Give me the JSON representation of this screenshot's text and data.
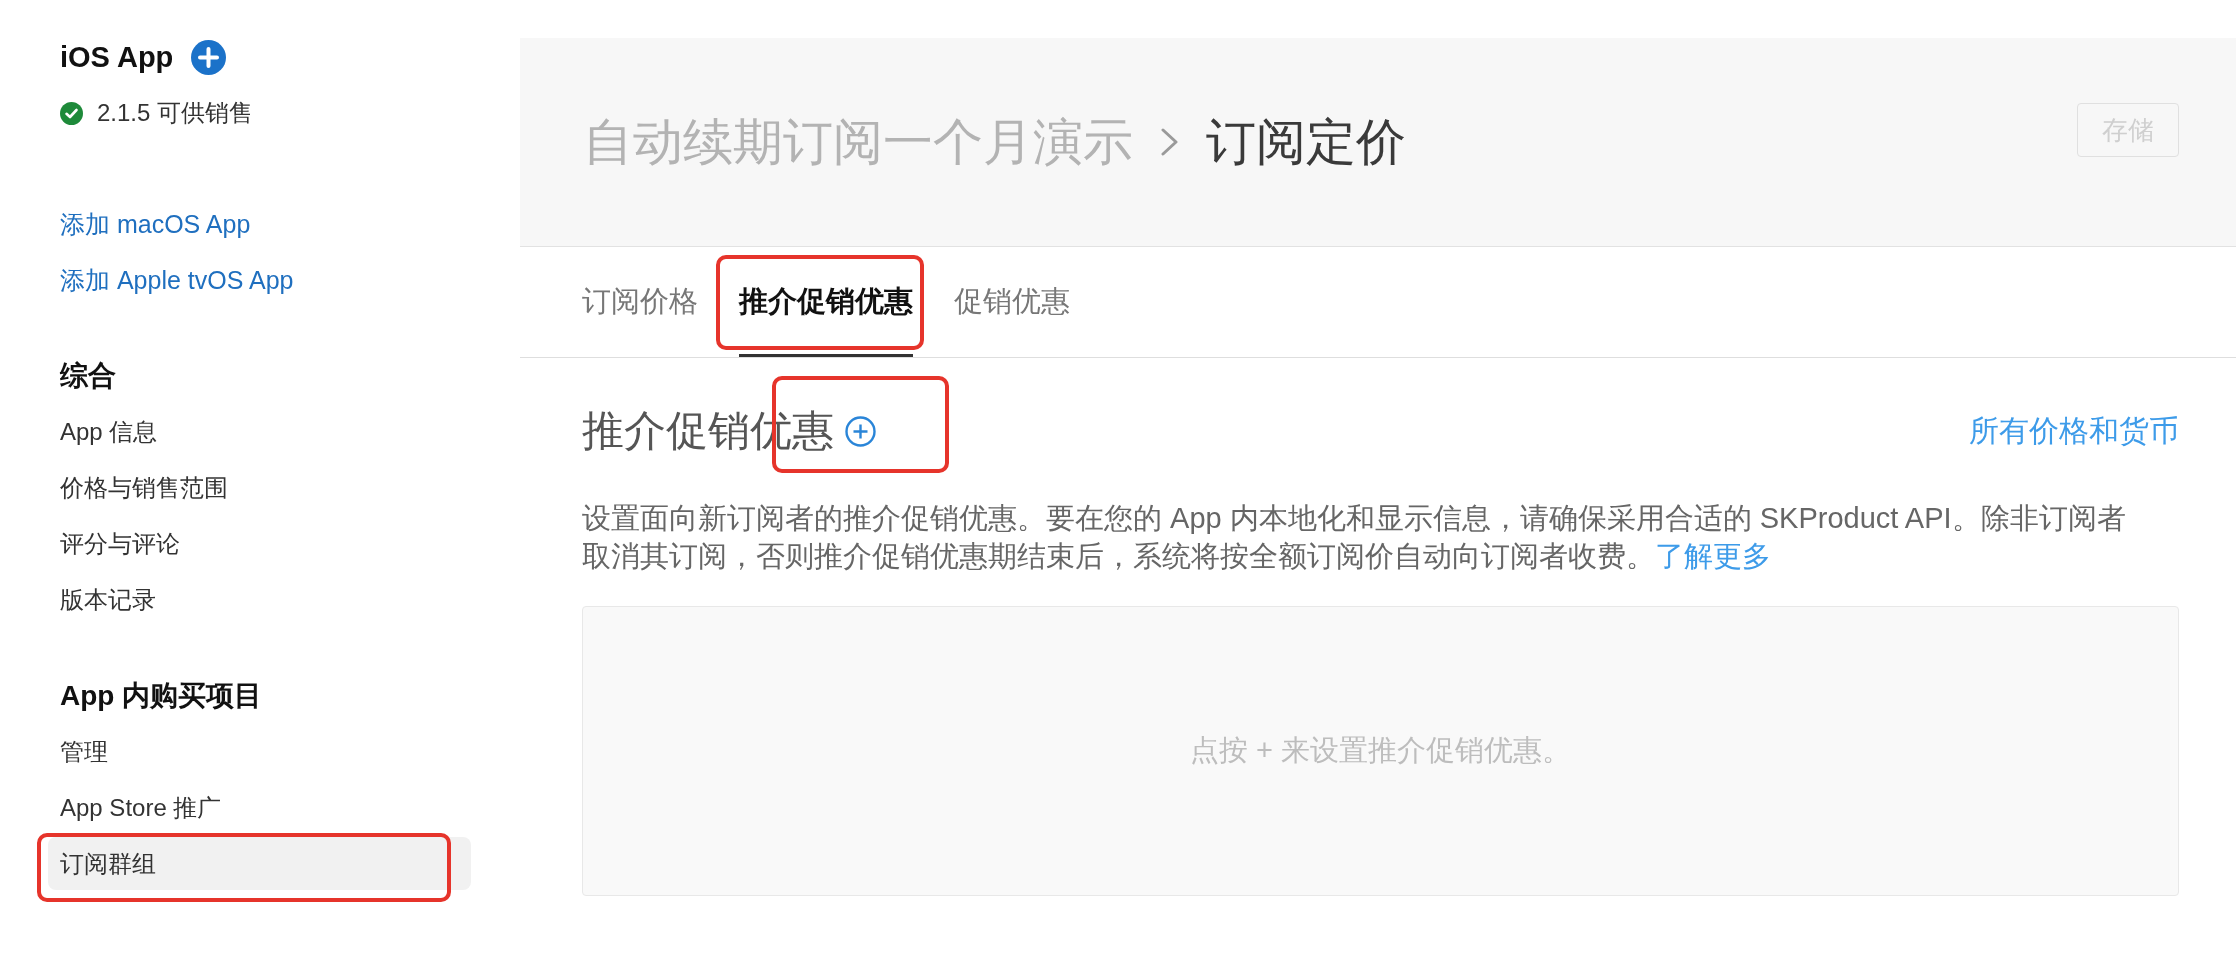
{
  "sidebar": {
    "app": {
      "title": "iOS App",
      "status": "2.1.5 可供销售"
    },
    "links": [
      "添加 macOS App",
      "添加 Apple tvOS App"
    ],
    "sections": [
      {
        "heading": "综合",
        "items": [
          {
            "label": "App 信息",
            "selected": false,
            "annotated": false
          },
          {
            "label": "价格与销售范围",
            "selected": false,
            "annotated": false
          },
          {
            "label": "评分与评论",
            "selected": false,
            "annotated": false
          },
          {
            "label": "版本记录",
            "selected": false,
            "annotated": false
          }
        ]
      },
      {
        "heading": "App 内购买项目",
        "items": [
          {
            "label": "管理",
            "selected": false,
            "annotated": false
          },
          {
            "label": "App Store 推广",
            "selected": false,
            "annotated": false
          },
          {
            "label": "订阅群组",
            "selected": true,
            "annotated": true
          }
        ]
      }
    ]
  },
  "header": {
    "breadcrumb": [
      {
        "label": "自动续期订阅一个月演示",
        "current": false
      },
      {
        "label": "订阅定价",
        "current": true
      }
    ],
    "save_button": {
      "label": "存储",
      "disabled": true
    }
  },
  "tabs": [
    {
      "label": "订阅价格",
      "selected": false,
      "annotated": false
    },
    {
      "label": "推介促销优惠",
      "selected": true,
      "annotated": true
    },
    {
      "label": "促销优惠",
      "selected": false,
      "annotated": false
    }
  ],
  "section": {
    "title": "推介促销优惠",
    "add_annotated": true,
    "link": "所有价格和货币",
    "description": "设置面向新订阅者的推介促销优惠。要在您的 App 内本地化和显示信息，请确保采用合适的 SKProduct API。除非订阅者取消其订阅，否则推介促销优惠期结束后，系统将按全额订阅价自动向订阅者收费。",
    "learn_more": "了解更多",
    "empty_state": "点按 + 来设置推介促销优惠。"
  }
}
